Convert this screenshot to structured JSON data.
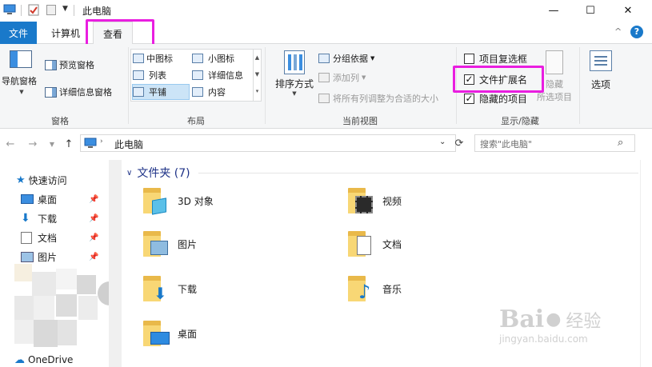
{
  "window": {
    "title": "此电脑",
    "min_glyph": "—",
    "max_glyph": "☐",
    "close_glyph": "✕"
  },
  "tabs": {
    "file": "文件",
    "computer": "计算机",
    "view": "查看",
    "collapse_glyph": "^",
    "help_glyph": "?"
  },
  "ribbon": {
    "panes": {
      "nav_pane": "导航窗格",
      "preview_pane": "预览窗格",
      "details_pane": "详细信息窗格",
      "group_label": "窗格"
    },
    "layout": {
      "items": [
        "中图标",
        "小图标",
        "列表",
        "详细信息",
        "平铺",
        "内容"
      ],
      "group_label": "布局"
    },
    "current_view": {
      "sort_by": "排序方式",
      "group_by": "分组依据",
      "add_columns": "添加列",
      "fit_columns": "将所有列调整为合适的大小",
      "group_label": "当前视图"
    },
    "show_hide": {
      "item_checkboxes": "项目复选框",
      "file_extensions": "文件扩展名",
      "hidden_items": "隐藏的项目",
      "hide": "隐藏",
      "hide_selected": "所选项目",
      "group_label": "显示/隐藏"
    },
    "options": "选项"
  },
  "address": {
    "path": "此电脑",
    "search_placeholder": "搜索\"此电脑\""
  },
  "nav_pane": {
    "quick_access": "快速访问",
    "items": [
      "桌面",
      "下载",
      "文档",
      "图片"
    ],
    "onedrive": "OneDrive"
  },
  "content": {
    "section_title": "文件夹 (7)",
    "folders": [
      "3D 对象",
      "视频",
      "图片",
      "文档",
      "下载",
      "音乐",
      "桌面"
    ]
  },
  "watermark": {
    "brand": "Bai",
    "brand_cn": "经验",
    "url": "jingyan.baidu.com"
  },
  "colors": {
    "file_tab": "#1979ca",
    "highlight": "#e91ee0",
    "folder": "#f8d775",
    "link_blue": "#1e3287"
  }
}
